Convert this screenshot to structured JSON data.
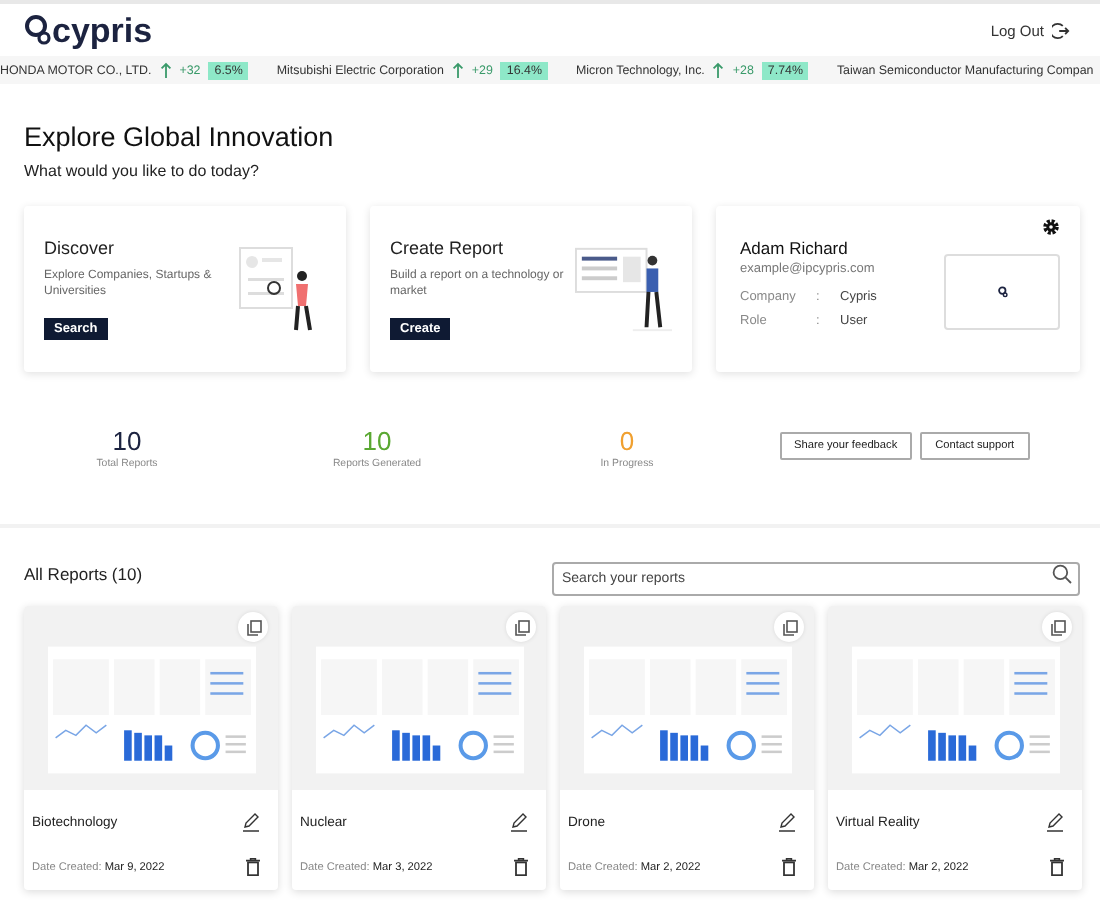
{
  "header": {
    "logo": "cypris",
    "logout": "Log Out"
  },
  "ticker": [
    {
      "name": "HONDA MOTOR CO., LTD.",
      "change": "+32",
      "percent": "6.5%"
    },
    {
      "name": "Mitsubishi Electric Corporation",
      "change": "+29",
      "percent": "16.4%"
    },
    {
      "name": "Micron Technology, Inc.",
      "change": "+28",
      "percent": "7.74%"
    },
    {
      "name": "Taiwan Semiconductor Manufacturing Compan"
    }
  ],
  "title": "Explore Global Innovation",
  "subtitle": "What would you like to do today?",
  "actions": [
    {
      "kind": "discover",
      "title": "Discover",
      "description": "Explore Companies, Startups & Universities",
      "button": "Search"
    },
    {
      "kind": "create",
      "title": "Create Report",
      "description": "Build a report on a technology or market",
      "button": "Create"
    }
  ],
  "profile": {
    "name": "Adam Richard",
    "email": "example@ipcypris.com",
    "fields": [
      {
        "label": "Company",
        "separator": ":",
        "value": "Cypris"
      },
      {
        "label": "Role",
        "separator": ":",
        "value": "User"
      }
    ]
  },
  "stats": [
    {
      "value": "10",
      "label": "Total Reports",
      "color": "#1c2340"
    },
    {
      "value": "10",
      "label": "Reports Generated",
      "color": "#5aa832"
    },
    {
      "value": "0",
      "label": "In Progress",
      "color": "#f0a030"
    }
  ],
  "support_buttons": [
    "Share your feedback",
    "Contact support"
  ],
  "reports": {
    "title": "All Reports (10)",
    "search": {
      "placeholder": "Search your reports"
    },
    "items": [
      {
        "name": "Biotechnology",
        "date_label": "Date Created:",
        "date": "Mar 9, 2022"
      },
      {
        "name": "Nuclear",
        "date_label": "Date Created:",
        "date": "Mar 3, 2022"
      },
      {
        "name": "Drone",
        "date_label": "Date Created:",
        "date": "Mar 2, 2022"
      },
      {
        "name": "Virtual Reality",
        "date_label": "Date Created:",
        "date": "Mar 2, 2022"
      }
    ]
  }
}
